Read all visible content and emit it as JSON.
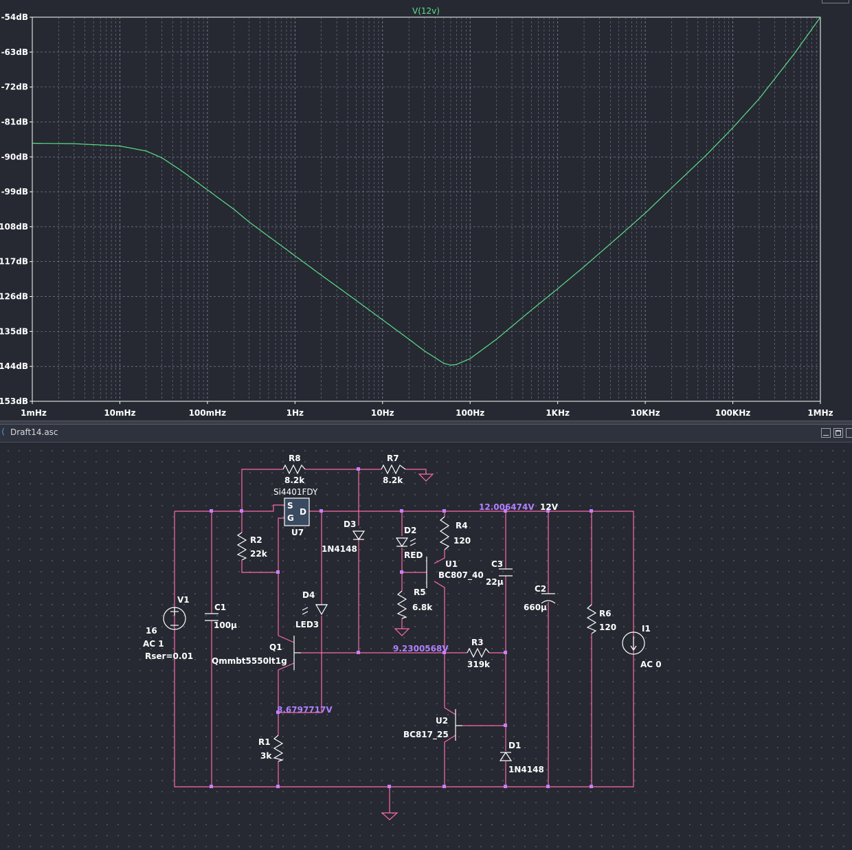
{
  "plot": {
    "trace_name": "V(12v)",
    "trace_color": "#5ce08a",
    "grid_color": "#8a90a8",
    "axis_text_color": "#ffffff",
    "y_ticks": [
      "-54dB",
      "-63dB",
      "-72dB",
      "-81dB",
      "-90dB",
      "-99dB",
      "108dB",
      "117dB",
      "126dB",
      "135dB",
      "144dB",
      "153dB"
    ],
    "x_ticks": [
      "1mHz",
      "10mHz",
      "100mHz",
      "1Hz",
      "10Hz",
      "100Hz",
      "1KHz",
      "10KHz",
      "100KHz",
      "1MHz"
    ]
  },
  "chart_data": {
    "type": "line",
    "x_scale": "log",
    "x_unit": "Hz",
    "y_unit": "dB",
    "xlim": [
      0.001,
      1000000
    ],
    "ylim": [
      -153,
      -54
    ],
    "grid": true,
    "series": [
      {
        "name": "V(12v)",
        "x": [
          0.001,
          0.003,
          0.01,
          0.02,
          0.03,
          0.05,
          0.1,
          0.2,
          0.3,
          0.5,
          1,
          2,
          5,
          10,
          20,
          30,
          50,
          60,
          70,
          100,
          200,
          500,
          1000,
          2000,
          5000,
          10000,
          20000,
          50000,
          100000,
          200000,
          500000,
          1000000
        ],
        "y": [
          -86.5,
          -86.6,
          -87.2,
          -88.5,
          -90.2,
          -93.5,
          -98.5,
          -103.5,
          -106.8,
          -110.5,
          -115.5,
          -120.5,
          -127.0,
          -132.0,
          -137.0,
          -140.0,
          -143.2,
          -143.7,
          -143.5,
          -142.0,
          -137.0,
          -129.5,
          -124.0,
          -118.3,
          -110.5,
          -104.5,
          -98.0,
          -89.5,
          -82.5,
          -75.0,
          -63.5,
          -54.0
        ]
      }
    ]
  },
  "schematic": {
    "window_title": "Draft14.asc",
    "wire_color": "#ff6aa8",
    "label_color": "#ffffff",
    "node_voltage_color": "#b080ff",
    "labels": {
      "r8_name": "R8",
      "r8_val": "8.2k",
      "r7_name": "R7",
      "r7_val": "8.2k",
      "u7_part": "Si4401FDY",
      "u7_name": "U7",
      "u7_s": "S",
      "u7_g": "G",
      "u7_d": "D",
      "r2_name": "R2",
      "r2_val": "22k",
      "d3_name": "D3",
      "d3_val": "1N4148",
      "d2_name": "D2",
      "d2_val": "RED",
      "r4_name": "R4",
      "r4_val": "120",
      "u1_name": "U1",
      "u1_val": "BC807_40",
      "c3_name": "C3",
      "c3_val": "22µ",
      "c2_name": "C2",
      "c2_val": "660µ",
      "node_12v": "12V",
      "v_12": "12.006474V",
      "v1_name": "V1",
      "v1_dc": "16",
      "v1_ac": "AC 1",
      "v1_rser": "Rser=0.01",
      "c1_name": "C1",
      "c1_val": "100µ",
      "d4_name": "D4",
      "d4_val": "LED3",
      "r5_name": "R5",
      "r5_val": "6.8k",
      "q1_name": "Q1",
      "q1_val": "Qmmbt5550lt1g",
      "v_923": "9.2300568V",
      "r3_name": "R3",
      "r3_val": "319k",
      "r6_name": "R6",
      "r6_val": "120",
      "i1_name": "I1",
      "i1_val": "AC 0",
      "v_868": "8.6797717V",
      "u2_name": "U2",
      "u2_val": "BC817_25",
      "r1_name": "R1",
      "r1_val": "3k",
      "d1_name": "D1",
      "d1_val": "1N4148"
    }
  }
}
